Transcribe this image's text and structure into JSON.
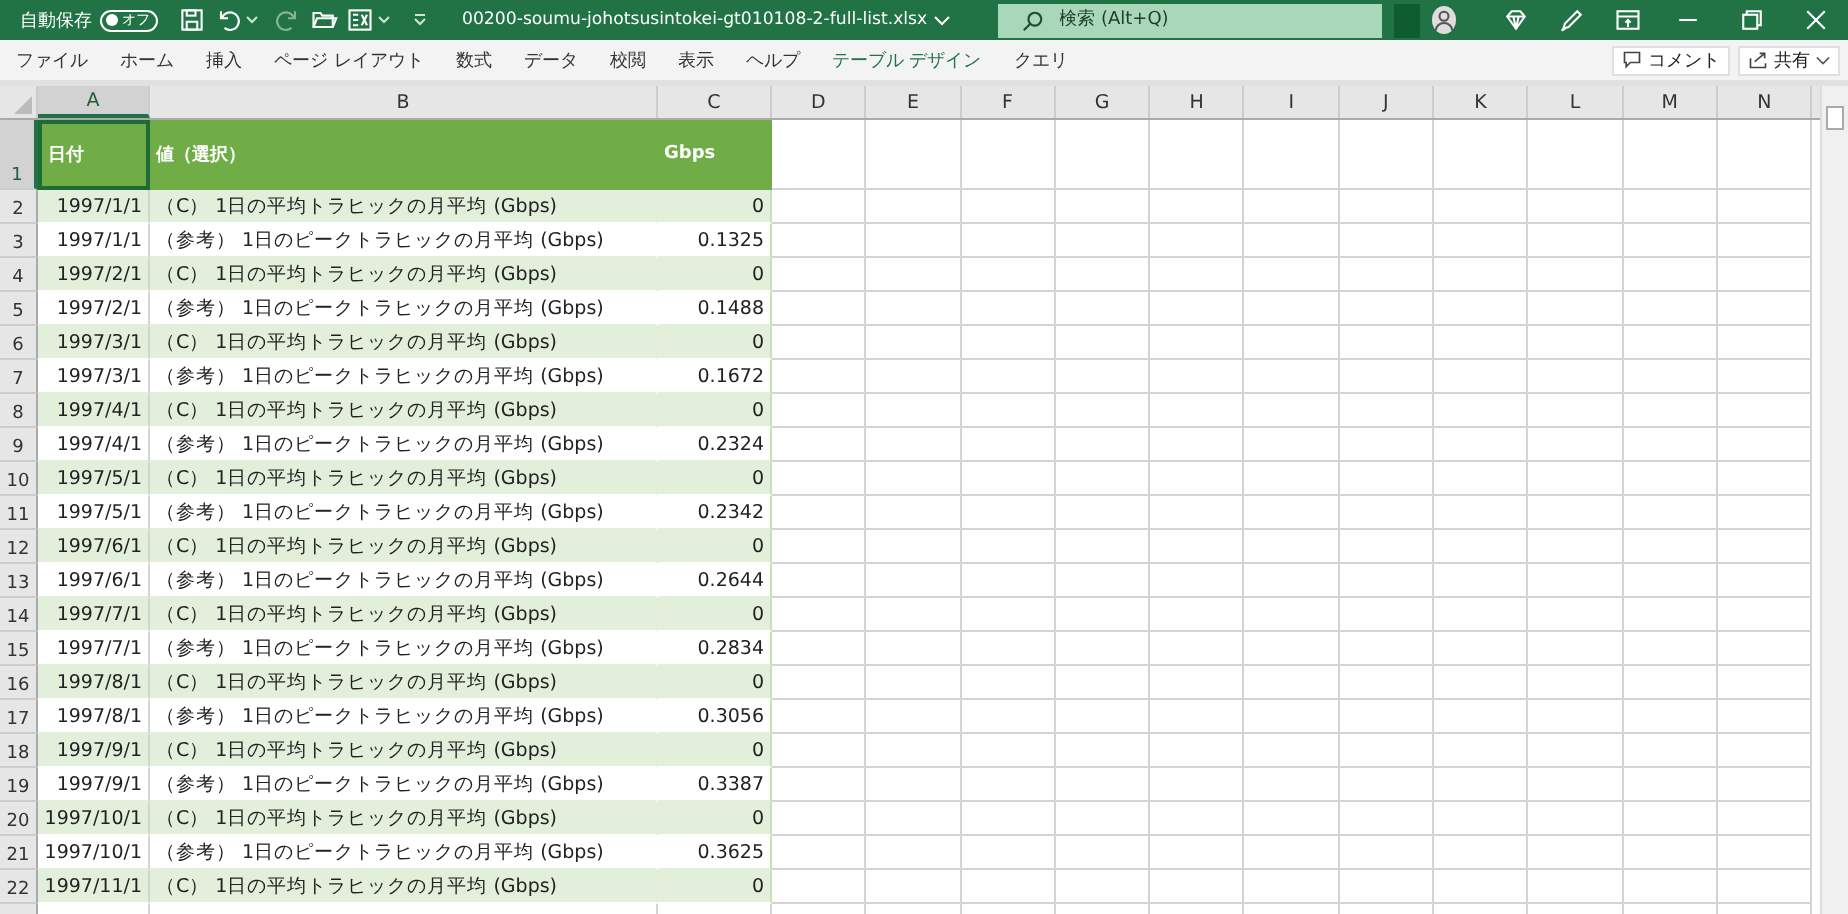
{
  "title_bar": {
    "autosave_label": "自動保存",
    "autosave": {
      "on": false,
      "label": "オフ"
    },
    "file_name": "00200-soumu-johotsusintokei-gt010108-2-full-list.xlsx",
    "search": {
      "placeholder": "検索 (Alt+Q)"
    }
  },
  "ribbon_tabs": [
    {
      "label": "ファイル",
      "kind": "normal"
    },
    {
      "label": "ホーム",
      "kind": "normal"
    },
    {
      "label": "挿入",
      "kind": "normal"
    },
    {
      "label": "ページ レイアウト",
      "kind": "normal"
    },
    {
      "label": "数式",
      "kind": "normal"
    },
    {
      "label": "データ",
      "kind": "normal"
    },
    {
      "label": "校閲",
      "kind": "normal"
    },
    {
      "label": "表示",
      "kind": "normal"
    },
    {
      "label": "ヘルプ",
      "kind": "normal"
    },
    {
      "label": "テーブル デザイン",
      "kind": "contextual"
    },
    {
      "label": "クエリ",
      "kind": "normal"
    }
  ],
  "ribbon_buttons": [
    "コメント",
    "共有"
  ],
  "sheet": {
    "columns": [
      {
        "label": "A",
        "selected": true
      },
      {
        "label": "B",
        "selected": false
      },
      {
        "label": "C",
        "selected": false
      },
      {
        "label": "D",
        "selected": false
      },
      {
        "label": "E",
        "selected": false
      },
      {
        "label": "F",
        "selected": false
      },
      {
        "label": "G",
        "selected": false
      },
      {
        "label": "H",
        "selected": false
      },
      {
        "label": "I",
        "selected": false
      },
      {
        "label": "J",
        "selected": false
      },
      {
        "label": "K",
        "selected": false
      },
      {
        "label": "L",
        "selected": false
      },
      {
        "label": "M",
        "selected": false
      },
      {
        "label": "N",
        "selected": false
      }
    ],
    "header_row": {
      "number": "1",
      "cells": [
        {
          "text": "日付",
          "selected": true
        },
        {
          "text": "値（選択）",
          "selected": false
        },
        {
          "text": "Gbps",
          "selected": false
        }
      ]
    },
    "rows": [
      {
        "number": "2",
        "date": "1997/1/1",
        "item": "（C） 1日の平均トラヒックの月平均 (Gbps)",
        "value": "0"
      },
      {
        "number": "3",
        "date": "1997/1/1",
        "item": "（参考） 1日のピークトラヒックの月平均 (Gbps)",
        "value": "0.1325"
      },
      {
        "number": "4",
        "date": "1997/2/1",
        "item": "（C） 1日の平均トラヒックの月平均 (Gbps)",
        "value": "0"
      },
      {
        "number": "5",
        "date": "1997/2/1",
        "item": "（参考） 1日のピークトラヒックの月平均 (Gbps)",
        "value": "0.1488"
      },
      {
        "number": "6",
        "date": "1997/3/1",
        "item": "（C） 1日の平均トラヒックの月平均 (Gbps)",
        "value": "0"
      },
      {
        "number": "7",
        "date": "1997/3/1",
        "item": "（参考） 1日のピークトラヒックの月平均 (Gbps)",
        "value": "0.1672"
      },
      {
        "number": "8",
        "date": "1997/4/1",
        "item": "（C） 1日の平均トラヒックの月平均 (Gbps)",
        "value": "0"
      },
      {
        "number": "9",
        "date": "1997/4/1",
        "item": "（参考） 1日のピークトラヒックの月平均 (Gbps)",
        "value": "0.2324"
      },
      {
        "number": "10",
        "date": "1997/5/1",
        "item": "（C） 1日の平均トラヒックの月平均 (Gbps)",
        "value": "0"
      },
      {
        "number": "11",
        "date": "1997/5/1",
        "item": "（参考） 1日のピークトラヒックの月平均 (Gbps)",
        "value": "0.2342"
      },
      {
        "number": "12",
        "date": "1997/6/1",
        "item": "（C） 1日の平均トラヒックの月平均 (Gbps)",
        "value": "0"
      },
      {
        "number": "13",
        "date": "1997/6/1",
        "item": "（参考） 1日のピークトラヒックの月平均 (Gbps)",
        "value": "0.2644"
      },
      {
        "number": "14",
        "date": "1997/7/1",
        "item": "（C） 1日の平均トラヒックの月平均 (Gbps)",
        "value": "0"
      },
      {
        "number": "15",
        "date": "1997/7/1",
        "item": "（参考） 1日のピークトラヒックの月平均 (Gbps)",
        "value": "0.2834"
      },
      {
        "number": "16",
        "date": "1997/8/1",
        "item": "（C） 1日の平均トラヒックの月平均 (Gbps)",
        "value": "0"
      },
      {
        "number": "17",
        "date": "1997/8/1",
        "item": "（参考） 1日のピークトラヒックの月平均 (Gbps)",
        "value": "0.3056"
      },
      {
        "number": "18",
        "date": "1997/9/1",
        "item": "（C） 1日の平均トラヒックの月平均 (Gbps)",
        "value": "0"
      },
      {
        "number": "19",
        "date": "1997/9/1",
        "item": "（参考） 1日のピークトラヒックの月平均 (Gbps)",
        "value": "0.3387"
      },
      {
        "number": "20",
        "date": "1997/10/1",
        "item": "（C） 1日の平均トラヒックの月平均 (Gbps)",
        "value": "0"
      },
      {
        "number": "21",
        "date": "1997/10/1",
        "item": "（参考） 1日のピークトラヒックの月平均 (Gbps)",
        "value": "0.3625"
      },
      {
        "number": "22",
        "date": "1997/11/1",
        "item": "（C） 1日の平均トラヒックの月平均 (Gbps)",
        "value": "0"
      }
    ]
  }
}
